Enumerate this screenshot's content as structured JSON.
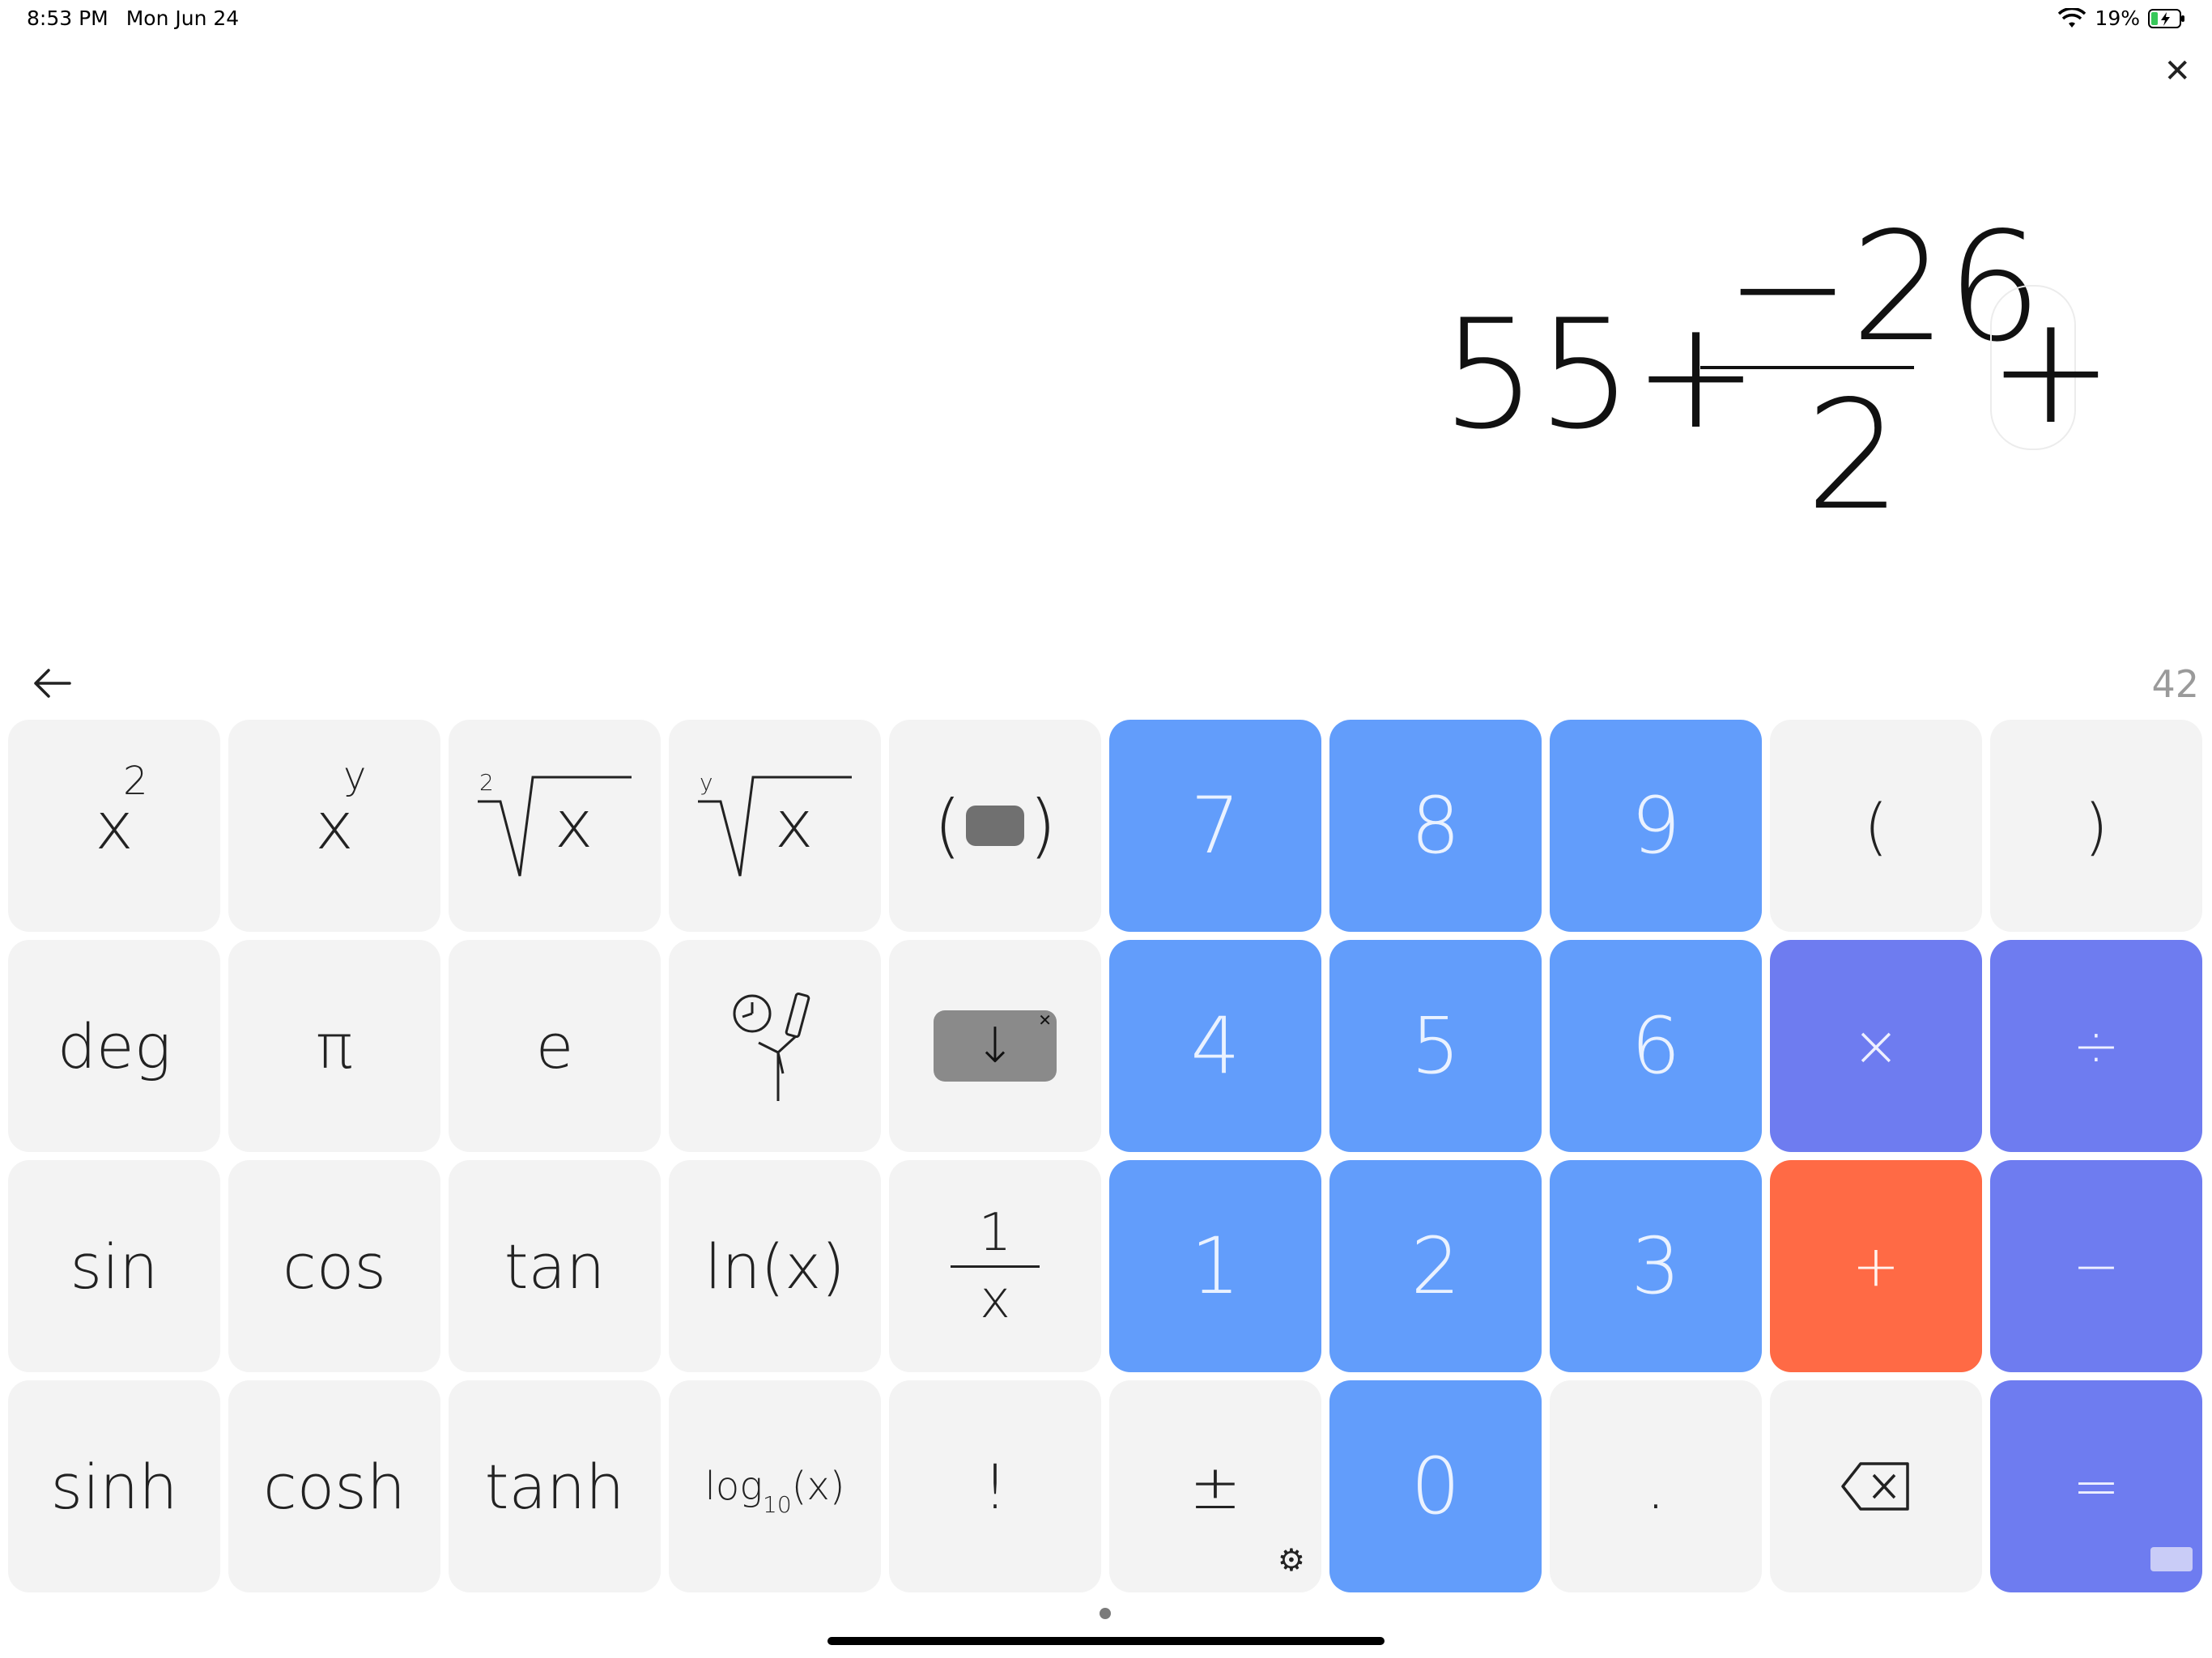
{
  "status": {
    "time": "8:53 PM",
    "date": "Mon Jun 24",
    "battery": "19%"
  },
  "expression": {
    "whole": "55+",
    "numerator": "−26",
    "denominator": "2",
    "trailing_operator": "+"
  },
  "result": "42",
  "keys": {
    "x_squared": {
      "base": "x",
      "sup": "2"
    },
    "x_pow_y": {
      "base": "x",
      "sup": "y"
    },
    "sqrt": {
      "index": "2",
      "radicand": "x"
    },
    "yroot": {
      "index": "y",
      "radicand": "x"
    },
    "paren_block": {
      "left": "(",
      "right": ")"
    },
    "seven": "7",
    "eight": "8",
    "nine": "9",
    "open_paren": "(",
    "close_paren": ")",
    "deg": "deg",
    "pi": "π",
    "e": "e",
    "convert_icon": "unit-conversion-icon",
    "down_arrow": "↓",
    "four": "4",
    "five": "5",
    "six": "6",
    "multiply": "×",
    "divide": "÷",
    "sin": "sin",
    "cos": "cos",
    "tan": "tan",
    "ln": "ln(x)",
    "recip": {
      "num": "1",
      "den": "x"
    },
    "one": "1",
    "two": "2",
    "three": "3",
    "plus": "+",
    "minus": "−",
    "sinh": "sinh",
    "cosh": "cosh",
    "tanh": "tanh",
    "log10": {
      "pre": "log",
      "sub": "10",
      "post": "(x)"
    },
    "factorial": "!",
    "plusminus": "±",
    "zero": "0",
    "dot": ".",
    "backspace_icon": "backspace-icon",
    "equals": "="
  },
  "colors": {
    "number_key": "#629dfb",
    "operator_key": "#6e7cf0",
    "active_operator": "#ff6a45",
    "function_key": "#f3f3f3"
  }
}
